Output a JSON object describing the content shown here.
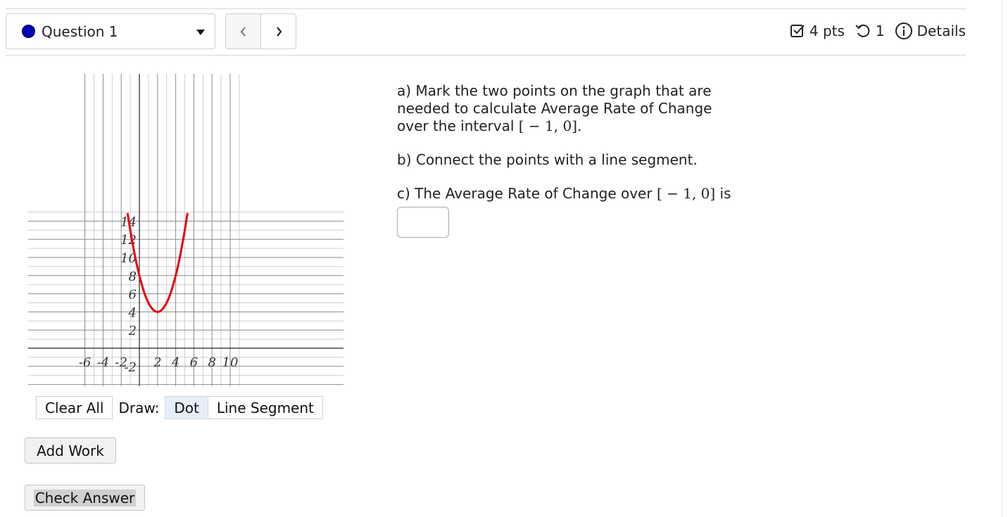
{
  "header": {
    "question_label": "Question 1",
    "prev_symbol": "<",
    "next_symbol": ">",
    "points": "4 pts",
    "attempts": "1",
    "details": "Details"
  },
  "graph": {
    "x_ticks": [
      "-6",
      "-4",
      "-2",
      "2",
      "4",
      "6",
      "8",
      "10"
    ],
    "y_ticks": [
      "14",
      "12",
      "10",
      "8",
      "6",
      "4",
      "2",
      "-2"
    ],
    "curve_color": "#e8000b",
    "curve_points": [
      [
        -1.3,
        15.47
      ],
      [
        -1,
        13
      ],
      [
        0,
        8
      ],
      [
        1,
        5
      ],
      [
        2,
        4
      ],
      [
        3,
        5
      ],
      [
        4,
        8
      ],
      [
        5,
        13
      ],
      [
        5.3,
        14.89
      ]
    ]
  },
  "toolbar": {
    "clear_all": "Clear All",
    "draw_label": "Draw:",
    "dot": "Dot",
    "line_segment": "Line Segment"
  },
  "question": {
    "part_a_text": "a) Mark the two points on the graph that are needed to calculate Average Rate of Change over the interval",
    "interval": "[ − 1, 0].",
    "part_b": "b) Connect the points with a line segment.",
    "part_c_text": "c) The Average Rate of Change over",
    "part_c_interval": "[ − 1, 0]",
    "part_c_suffix": "is"
  },
  "buttons": {
    "add_work": "Add Work",
    "check_answer": "Check Answer"
  }
}
